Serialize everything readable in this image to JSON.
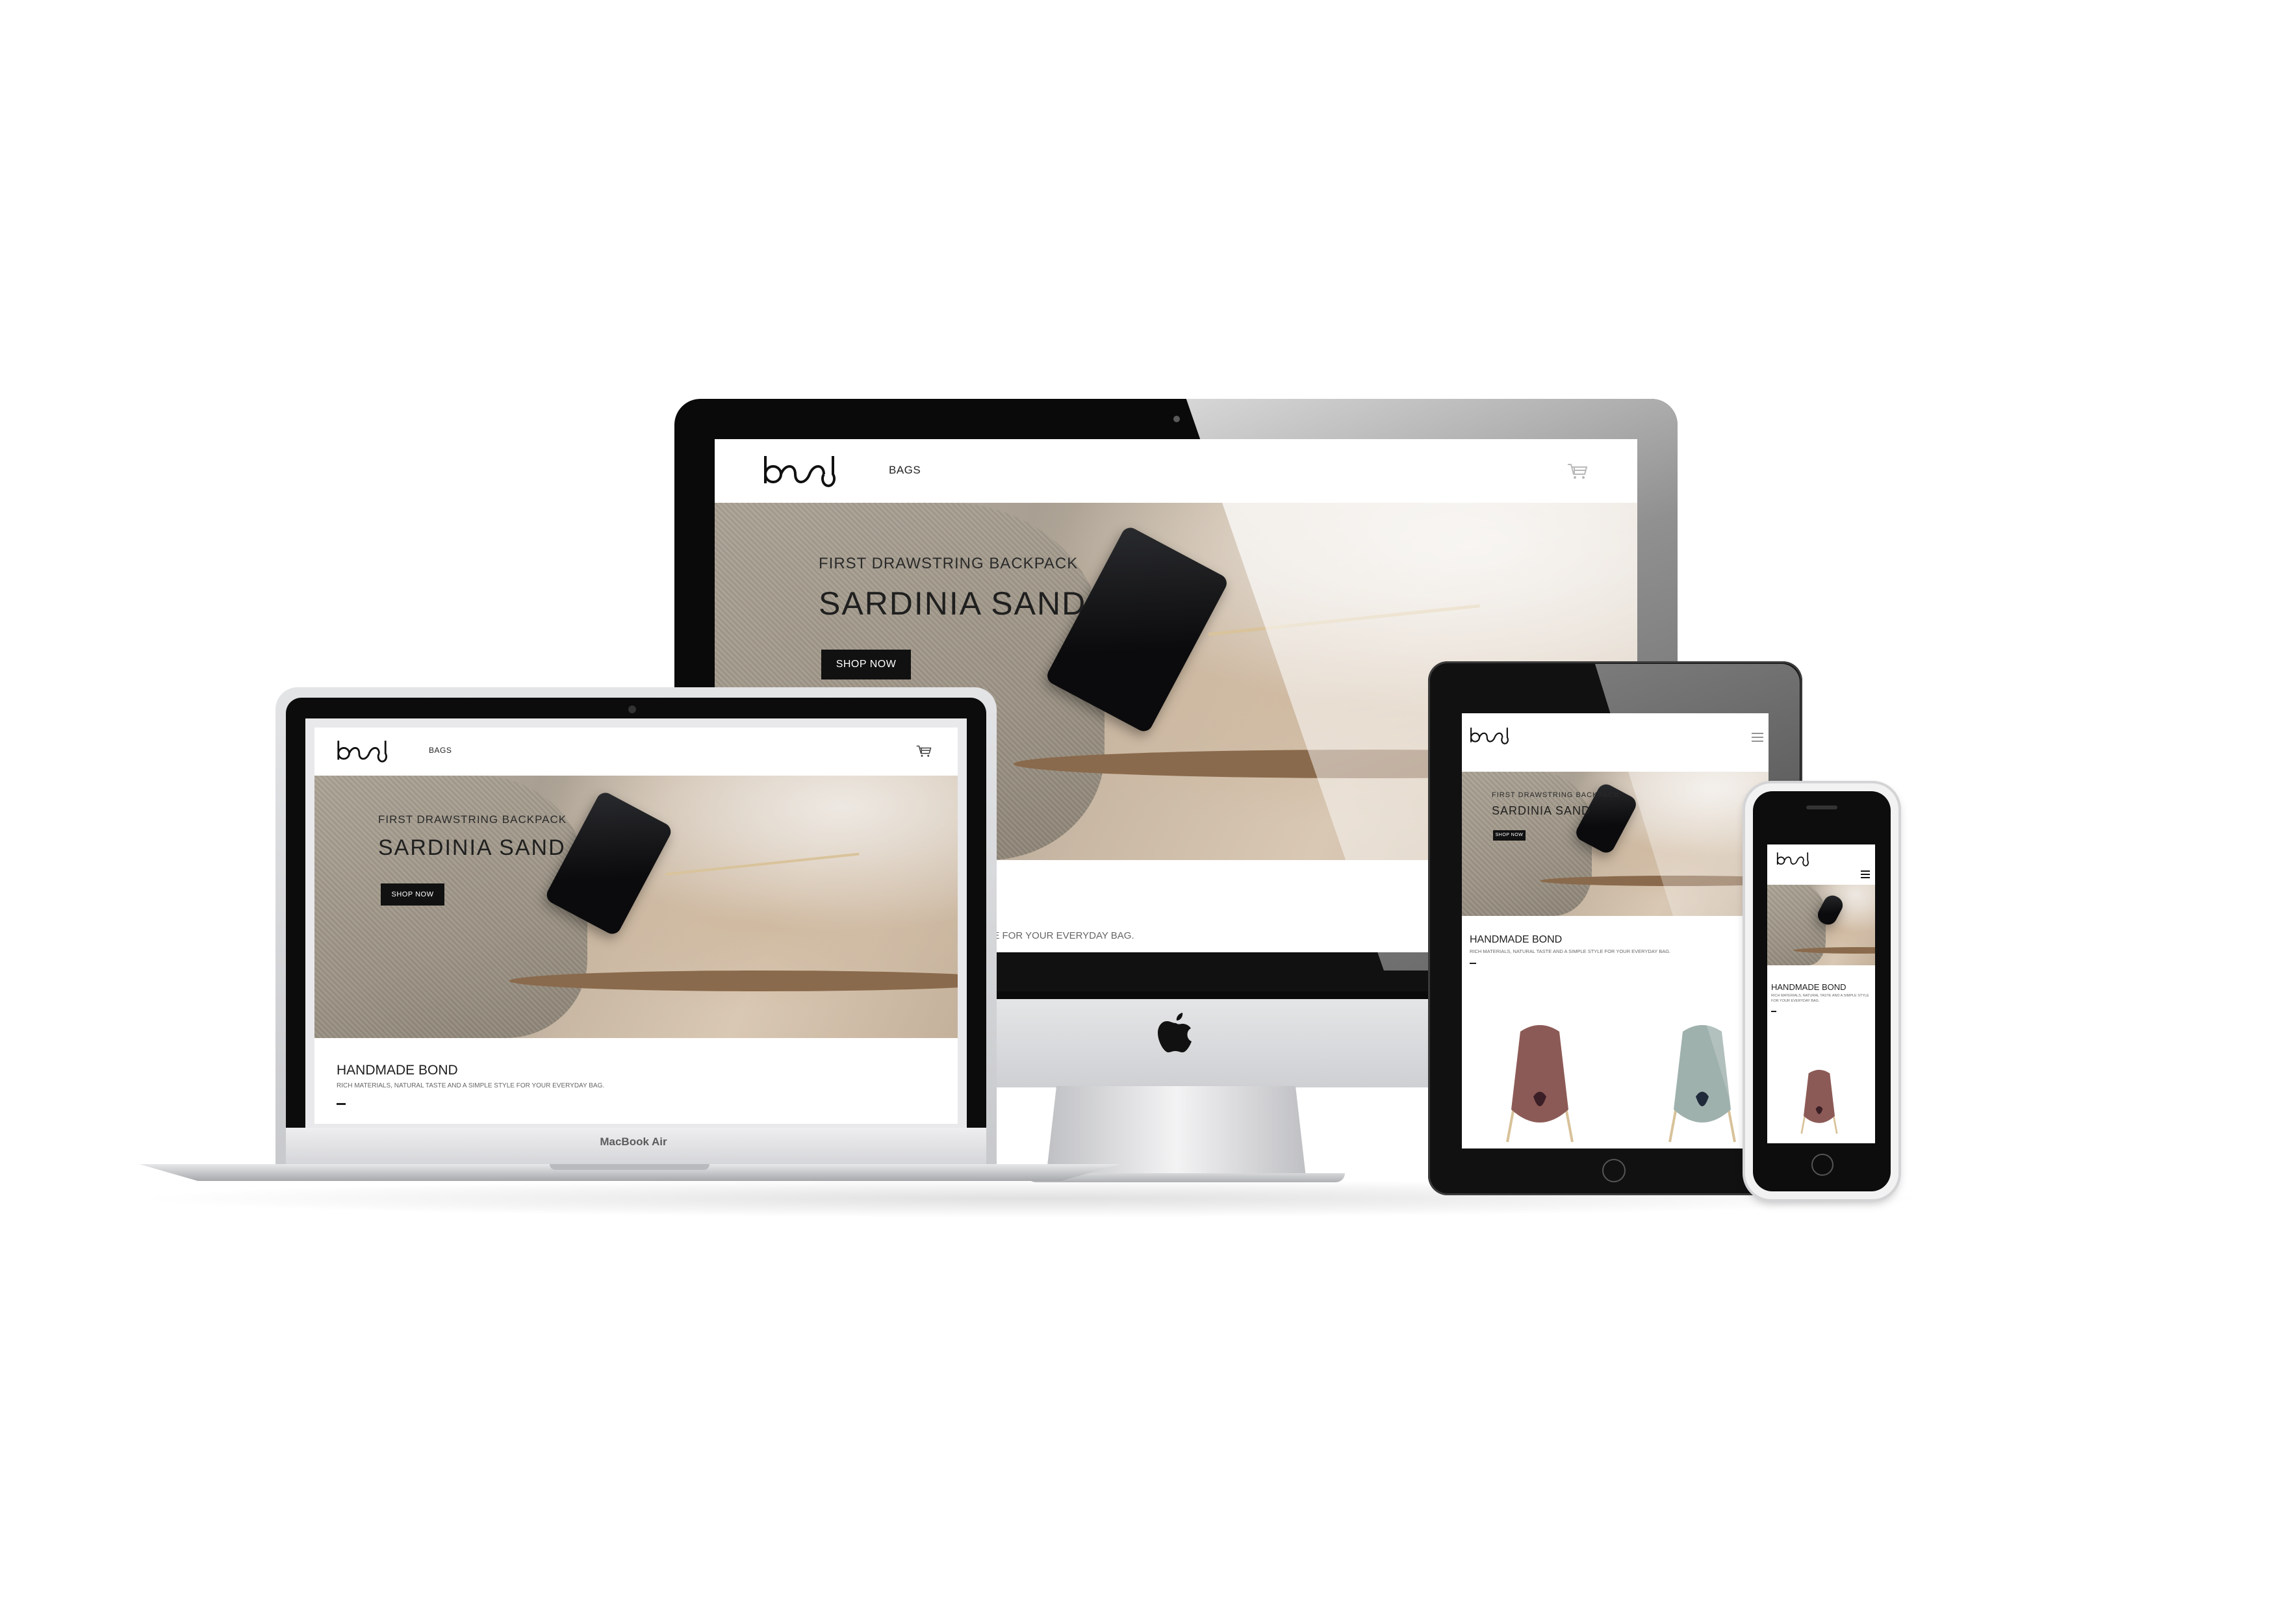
{
  "brand": {
    "logo_text": "bond"
  },
  "site": {
    "nav_bags": "BAGS",
    "hero": {
      "eyebrow": "FIRST DRAWSTRING BACKPACK",
      "title": "SARDINIA SAND",
      "cta": "SHOP NOW"
    },
    "section": {
      "title": "HANDMADE BOND",
      "text": "RICH MATERIALS, NATURAL TASTE AND A SIMPLE STYLE FOR YOUR EVERYDAY BAG.",
      "text_partial": "LE FOR YOUR EVERYDAY BAG.",
      "text_phone_line1": "RICH MATERIALS, NATURAL TASTE AND A SIMPLE STYLE",
      "text_phone_line2": "FOR YOUR EVERYDAY BAG."
    },
    "products": [
      {
        "name": "burgundy-drawstring-backpack",
        "color": "#8c5a56"
      },
      {
        "name": "sage-drawstring-backpack",
        "color": "#9fb1ad"
      }
    ]
  },
  "devices": {
    "laptop_label": "MacBook Air"
  },
  "icons": {
    "cart": "cart-icon",
    "menu": "hamburger-menu-icon",
    "apple": "apple-logo-icon"
  },
  "colors": {
    "button_bg": "#111111",
    "accent_sand": "#c9b8a4",
    "text_dark": "#1e1e1e"
  }
}
